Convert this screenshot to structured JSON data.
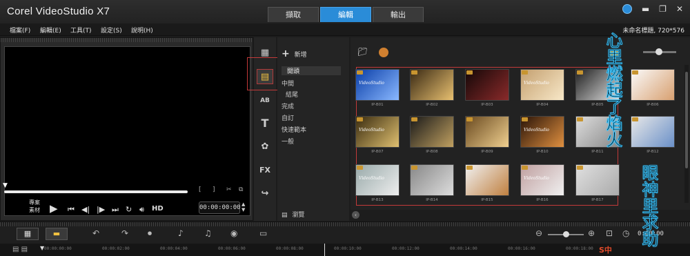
{
  "app": {
    "title": "Corel VideoStudio X7"
  },
  "steps": [
    {
      "label": "擷取",
      "active": false
    },
    {
      "label": "編輯",
      "active": true
    },
    {
      "label": "輸出",
      "active": false
    }
  ],
  "window_controls": [
    "globe-icon",
    "minimize-icon",
    "restore-icon",
    "close-icon"
  ],
  "menu": [
    "檔案(F)",
    "編輯(E)",
    "工具(T)",
    "設定(S)",
    "說明(H)"
  ],
  "project_info": "未命名標題, 720*576",
  "player": {
    "mode_labels": [
      "專案",
      "素材"
    ],
    "timecode": "00:00:00:00",
    "hd_label": "HD"
  },
  "left_icons": [
    "media-icon",
    "instant-project-icon",
    "transition-icon",
    "title-icon",
    "graphic-icon",
    "filter-icon",
    "path-icon"
  ],
  "instant_project": {
    "add_label": "新增",
    "categories": [
      "開頭",
      "中間",
      "結尾",
      "完成",
      "自訂",
      "快速範本",
      "一般"
    ],
    "selected_index": 0,
    "browse_label": "瀏覽"
  },
  "library": {
    "templates": [
      {
        "label": "IP-B01"
      },
      {
        "label": "IP-B02"
      },
      {
        "label": "IP-B03"
      },
      {
        "label": "IP-B04"
      },
      {
        "label": "IP-B05"
      },
      {
        "label": "IP-B06"
      },
      {
        "label": "IP-B07"
      },
      {
        "label": "IP-B08"
      },
      {
        "label": "IP-B09"
      },
      {
        "label": "IP-B10"
      },
      {
        "label": "IP-B11"
      },
      {
        "label": "IP-B12"
      },
      {
        "label": "IP-B13"
      },
      {
        "label": "IP-B14"
      },
      {
        "label": "IP-B15"
      },
      {
        "label": "IP-B16"
      },
      {
        "label": "IP-B17"
      }
    ],
    "thumb_title": "VideoStudio"
  },
  "timeline": {
    "ticks": [
      "00:00:00:00",
      "00:00:02:00",
      "00:00:04:00",
      "00:00:06:00",
      "00:00:08:00",
      "00:00:10:00",
      "00:00:12:00",
      "00:00:14:00",
      "00:00:16:00",
      "00:00:18:00"
    ],
    "duration": "0:00:00"
  },
  "overlay_text": {
    "left": "心里燃起了焰火",
    "right": "眼神里求助"
  },
  "watermark": "S中"
}
